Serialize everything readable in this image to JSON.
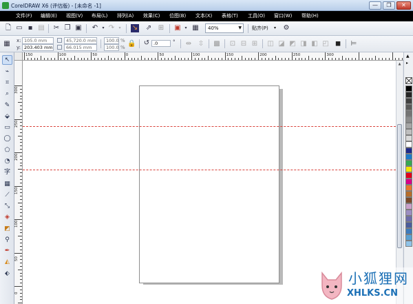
{
  "window": {
    "title": "CorelDRAW X6 (评估版) - [未命名 -1]",
    "buttons": {
      "minimize": "—",
      "restore": "❐",
      "close": "✕"
    }
  },
  "menu": [
    "文件(F)",
    "编辑(E)",
    "视图(V)",
    "布局(L)",
    "排列(A)",
    "效果(C)",
    "位图(B)",
    "文本(X)",
    "表格(T)",
    "工具(O)",
    "窗口(W)",
    "帮助(H)"
  ],
  "toolbar": {
    "zoom": "40%",
    "snap_label": "贴齐(P)"
  },
  "property_bar": {
    "x_label": "x:",
    "y_label": "y:",
    "x": "105.0 mm",
    "y": "203.403 mm",
    "width": "45,720.0 mm",
    "height": "66.015 mm",
    "scale_x": "100.0",
    "scale_y": "100.0",
    "percent": "%",
    "rotation": ".0",
    "degree": "°"
  },
  "ruler": {
    "top_labels": [
      "150",
      "100",
      "50",
      "0",
      "50",
      "100",
      "150",
      "200",
      "250",
      "300"
    ],
    "left_labels": [
      "300",
      "250",
      "200",
      "150",
      "100",
      "50",
      "0"
    ]
  },
  "toolbox": {
    "text_tool": "字"
  },
  "palette": {
    "colors": [
      "#000000",
      "#262626",
      "#404040",
      "#595959",
      "#737373",
      "#8c8c8c",
      "#a6a6a6",
      "#bfbfbf",
      "#d9d9d9",
      "#ffffff",
      "#1f2a8a",
      "#1d7ac9",
      "#35a853",
      "#f2e600",
      "#e2001a",
      "#d6008a",
      "#e8762c",
      "#b66d2a",
      "#7b4a2a",
      "#c9a0c9",
      "#9b8ec2",
      "#6c6caa",
      "#4b5d9c",
      "#3d7bbd",
      "#5aa0d2",
      "#8fc3e8"
    ]
  },
  "watermark": {
    "cn": "小狐狸网",
    "en": "XHLKS.CN"
  }
}
